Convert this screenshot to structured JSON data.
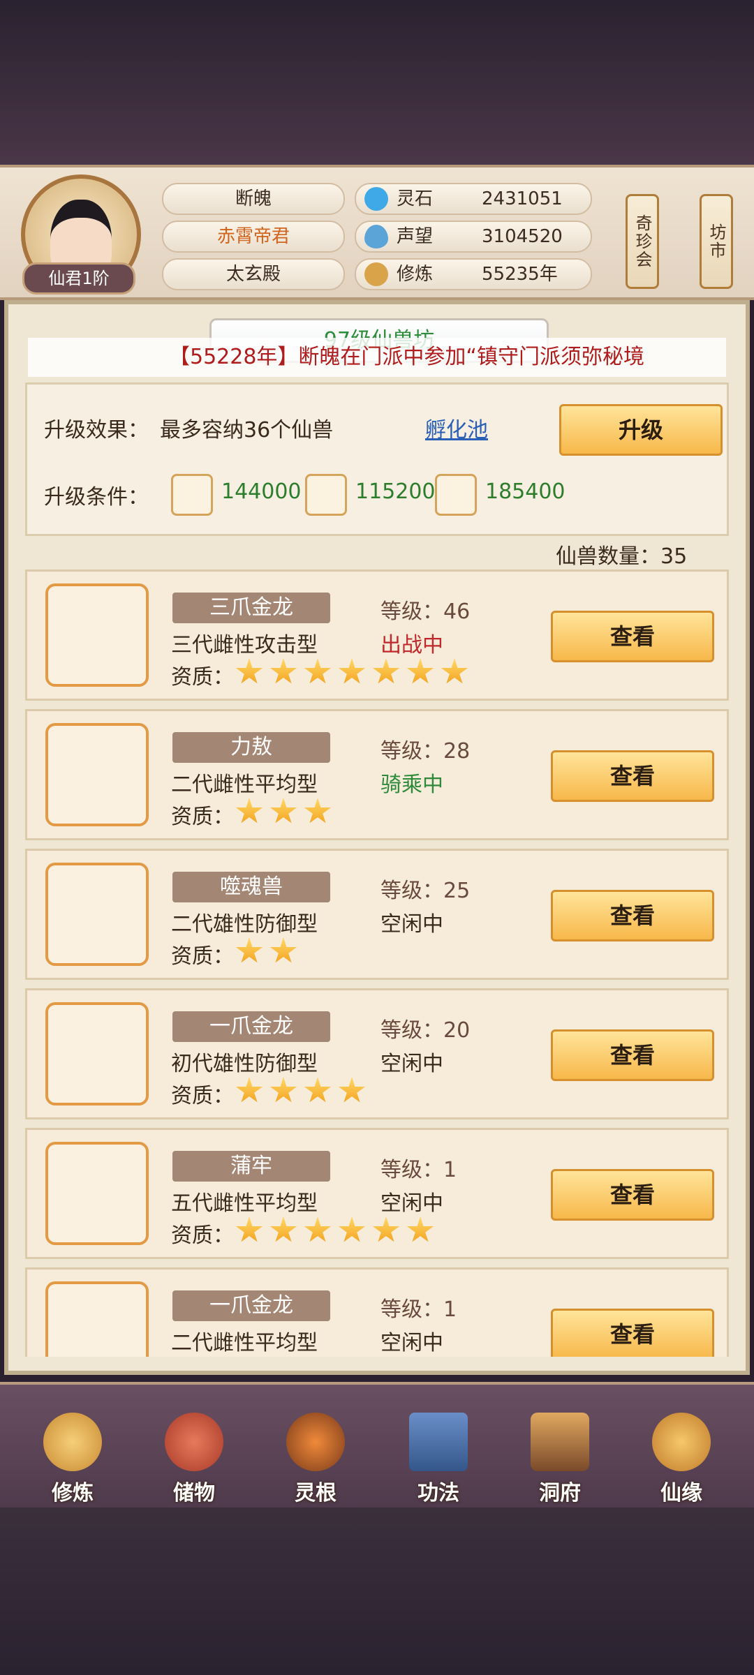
{
  "player": {
    "rank": "仙君1阶",
    "name": "断魄",
    "title": "赤霄帝君",
    "sect": "太玄殿"
  },
  "resources": [
    {
      "icon": "spirit-stone-icon",
      "label": "灵石",
      "value": "2431051",
      "color": "#3fa9e8"
    },
    {
      "icon": "reputation-icon",
      "label": "声望",
      "value": "3104520",
      "color": "#5aa4d8"
    },
    {
      "icon": "cultivation-icon",
      "label": "修炼",
      "value": "55235年",
      "color": "#d9a34a"
    }
  ],
  "side_buttons": {
    "treasure": "奇珍会",
    "market": "坊市"
  },
  "page_title": "97级仙兽坊",
  "marquee": {
    "text": "【55228年】断魄在门派中参加“镇守门派须弥秘境"
  },
  "upgrade": {
    "effect_label": "升级效果：",
    "effect_text": "最多容纳36个仙兽",
    "link": "孵化池",
    "button": "升级",
    "cond_label": "升级条件：",
    "materials": [
      {
        "icon": "ore-icon",
        "value": "144000"
      },
      {
        "icon": "wood-icon",
        "value": "115200"
      },
      {
        "icon": "herb-icon",
        "value": "185400"
      }
    ]
  },
  "beast_count": "仙兽数量：35",
  "beasts": [
    {
      "name": "三爪金龙",
      "type": "三代雌性攻击型",
      "level": "等级：46",
      "status": "出战中",
      "status_color": "#c0282c",
      "stars": 7,
      "icon": "golden-dragon-icon",
      "color": "#d8a040"
    },
    {
      "name": "力敖",
      "type": "二代雌性平均型",
      "level": "等级：28",
      "status": "骑乘中",
      "status_color": "#2c8a3a",
      "stars": 3,
      "icon": "beast-liao-icon",
      "color": "#4c9fb0"
    },
    {
      "name": "噬魂兽",
      "type": "二代雄性防御型",
      "level": "等级：25",
      "status": "空闲中",
      "status_color": "#3a2a1e",
      "stars": 2,
      "icon": "soul-beast-icon",
      "color": "#d03a2a"
    },
    {
      "name": "一爪金龙",
      "type": "初代雄性防御型",
      "level": "等级：20",
      "status": "空闲中",
      "status_color": "#3a2a1e",
      "stars": 4,
      "icon": "golden-dragon-icon",
      "color": "#d8a040"
    },
    {
      "name": "蒲牢",
      "type": "五代雌性平均型",
      "level": "等级：1",
      "status": "空闲中",
      "status_color": "#3a2a1e",
      "stars": 6,
      "icon": "pulao-icon",
      "color": "#c8342e"
    },
    {
      "name": "一爪金龙",
      "type": "二代雌性平均型",
      "level": "等级：1",
      "status": "空闲中",
      "status_color": "#3a2a1e",
      "stars": 0,
      "icon": "golden-dragon-icon",
      "color": "#d8a040"
    }
  ],
  "quality_label": "资质：",
  "view_button": "查看",
  "nav": [
    {
      "label": "修炼",
      "icon": "meditate-icon",
      "color": "#e0a040"
    },
    {
      "label": "储物",
      "icon": "bag-icon",
      "color": "#c94a3a"
    },
    {
      "label": "灵根",
      "icon": "spirit-root-icon",
      "color": "#d0502a"
    },
    {
      "label": "功法",
      "icon": "book-icon",
      "color": "#3f6aa8"
    },
    {
      "label": "洞府",
      "icon": "cave-dwelling-icon",
      "color": "#b87a3a"
    },
    {
      "label": "仙缘",
      "icon": "gourd-icon",
      "color": "#e4a03a"
    }
  ]
}
